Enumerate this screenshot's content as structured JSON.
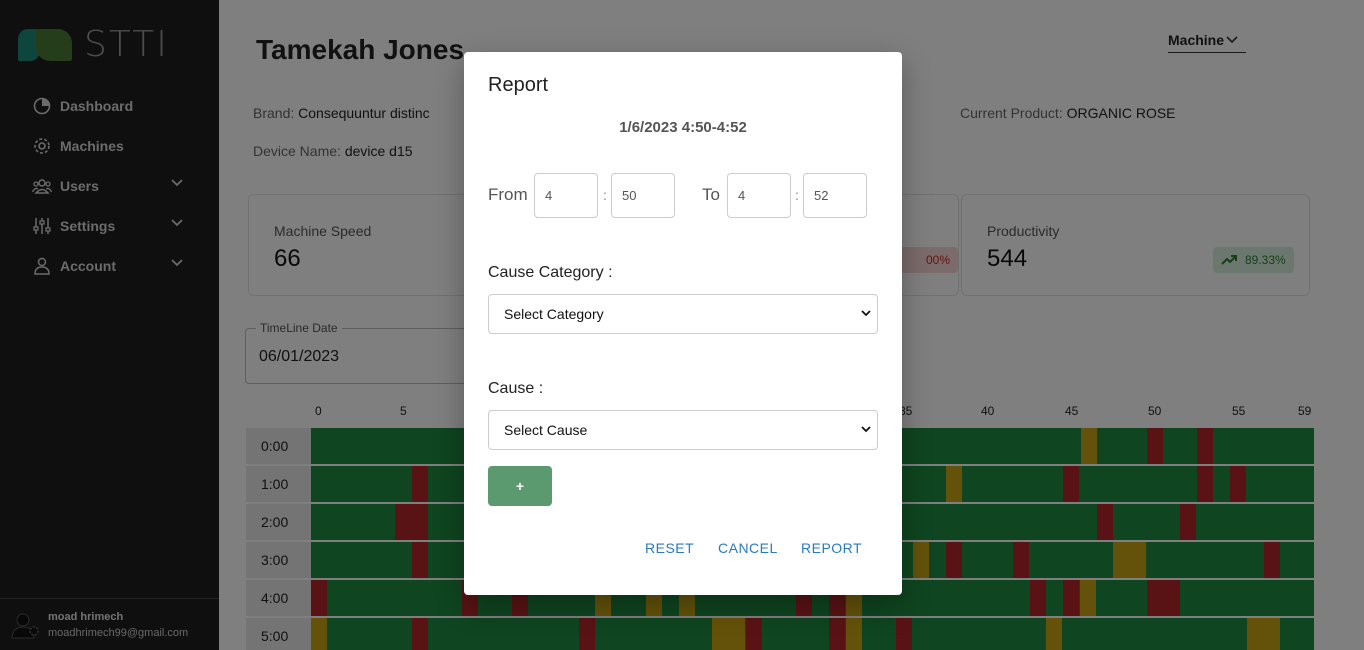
{
  "sidebar": {
    "logo_text": "STTI",
    "items": [
      {
        "label": "Dashboard",
        "icon": "dashboard-icon"
      },
      {
        "label": "Machines",
        "icon": "gear-icon"
      },
      {
        "label": "Users",
        "icon": "users-icon",
        "expandable": true
      },
      {
        "label": "Settings",
        "icon": "sliders-icon",
        "expandable": true
      },
      {
        "label": "Account",
        "icon": "person-icon",
        "expandable": true
      }
    ],
    "user": {
      "name": "moad hrimech",
      "email": "moadhrimech99@gmail.com"
    }
  },
  "header": {
    "title": "Tamekah Jones",
    "machine_select": "Machine"
  },
  "info": {
    "brand_label": "Brand:",
    "brand_value": "Consequuntur distinc",
    "device_label": "Device Name:",
    "device_value": "device d15",
    "product_label": "Current Product:",
    "product_value": "ORGANIC ROSE"
  },
  "cards": {
    "speed": {
      "label": "Machine Speed",
      "value": "66"
    },
    "hidden_badge": "00%",
    "productivity": {
      "label": "Productivity",
      "value": "544",
      "badge": "89.33%"
    }
  },
  "timeline": {
    "date_label": "TimeLine Date",
    "date_value": "06/01/2023",
    "minute_ticks": [
      "0",
      "5",
      "35",
      "40",
      "45",
      "50",
      "55",
      "59"
    ],
    "hours": [
      "0:00",
      "1:00",
      "2:00",
      "3:00",
      "4:00",
      "5:00"
    ]
  },
  "modal": {
    "title": "Report",
    "subtitle": "1/6/2023 4:50-4:52",
    "from_label": "From",
    "to_label": "To",
    "from_hour": "4",
    "from_min": "50",
    "to_hour": "4",
    "to_min": "52",
    "colon": ":",
    "cause_category_label": "Cause Category :",
    "cause_category_value": "Select Category",
    "cause_label": "Cause :",
    "cause_value": "Select Cause",
    "add_label": "+",
    "reset": "RESET",
    "cancel": "CANCEL",
    "report": "REPORT"
  },
  "colors": {
    "green": "#1e8a40",
    "red": "#b3262b",
    "yellow": "#c8a415",
    "accent": "#2a79c2"
  }
}
